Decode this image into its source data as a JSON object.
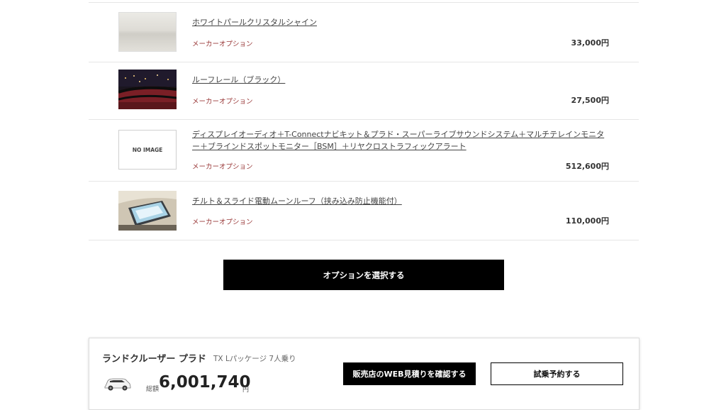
{
  "options": [
    {
      "name": "ホワイトパールクリスタルシャイン",
      "tag": "メーカーオプション",
      "price": "33,000円",
      "image": "white-pearl-swatch"
    },
    {
      "name": "ルーフレール（ブラック）",
      "tag": "メーカーオプション",
      "price": "27,500円",
      "image": "roof-rail-photo"
    },
    {
      "name": "ディスプレイオーディオ＋T-Connectナビキット＆プラド・スーパーライブサウンドシステム＋マルチテレインモニター＋ブラインドスポットモニター［BSM］＋リヤクロストラフィックアラート",
      "tag": "メーカーオプション",
      "price": "512,600円",
      "image_text": "NO IMAGE"
    },
    {
      "name": "チルト＆スライド電動ムーンルーフ（挟み込み防止機能付）",
      "tag": "メーカーオプション",
      "price": "110,000円",
      "image": "moonroof-photo"
    }
  ],
  "select_button": "オプションを選択する",
  "summary": {
    "model": "ランドクルーザー プラド",
    "grade": "TX Lパッケージ 7人乗り",
    "total_label": "総額",
    "total": "6,001,740",
    "currency": "円",
    "estimate_button": "販売店のWEB見積りを確認する",
    "test_drive_button": "試乗予約する"
  }
}
